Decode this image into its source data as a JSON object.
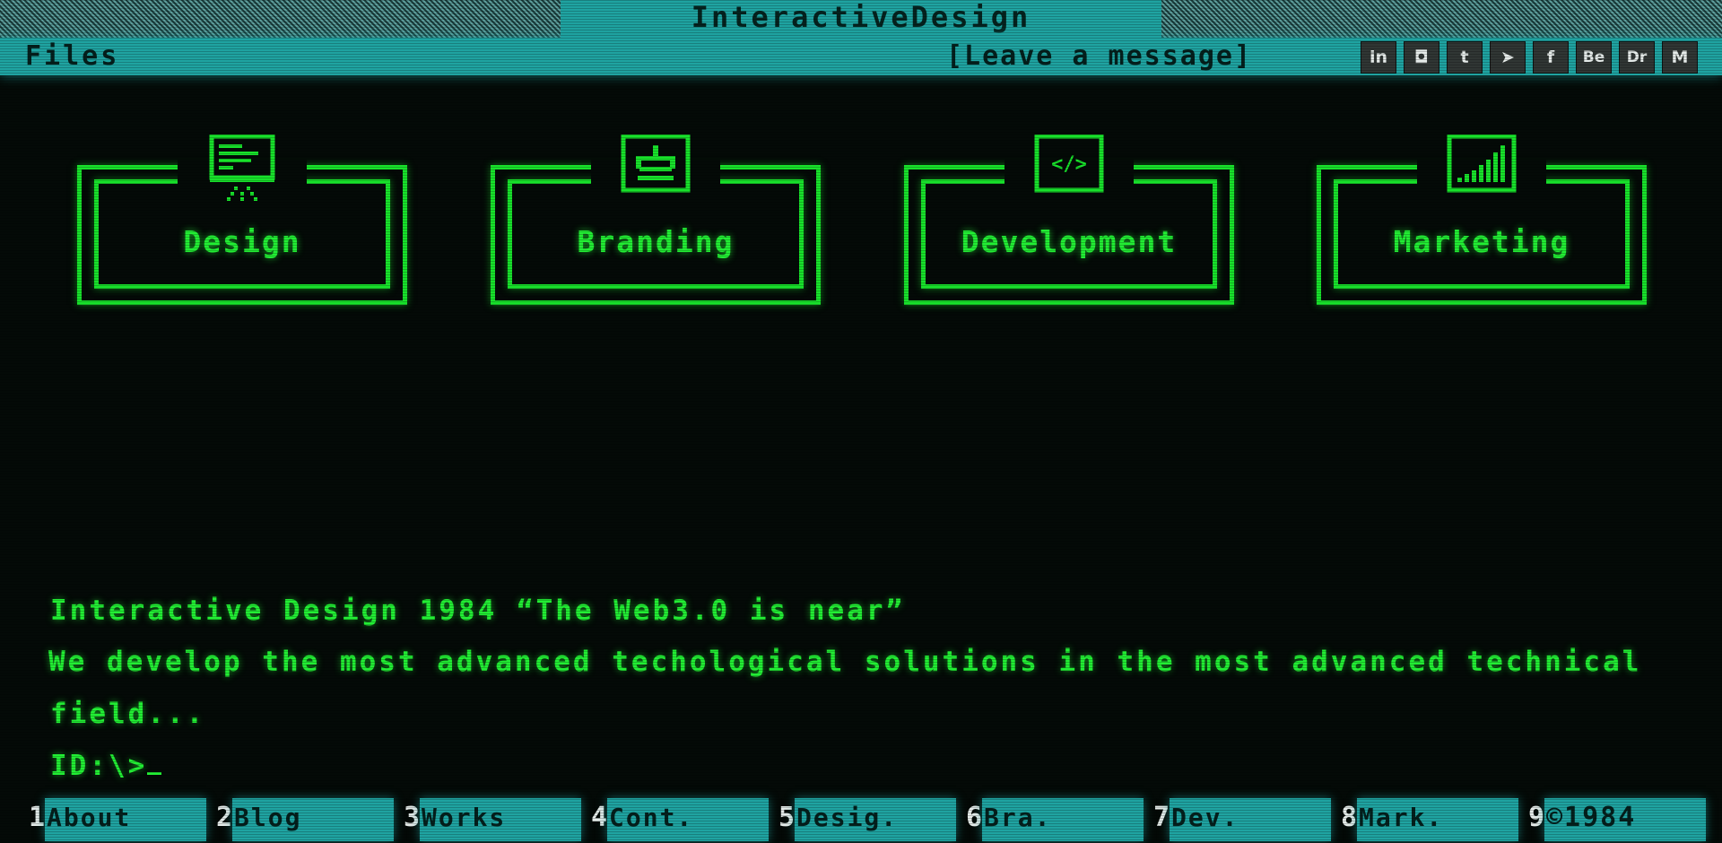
{
  "title": "InteractiveDesign",
  "menu": {
    "files": "Files",
    "message": "[Leave a message]"
  },
  "social": [
    {
      "label": "in",
      "icon": "linkedin-icon"
    },
    {
      "label": "◘",
      "icon": "instagram-icon"
    },
    {
      "label": "t",
      "icon": "tumblr-icon"
    },
    {
      "label": "➤",
      "icon": "telegram-icon"
    },
    {
      "label": "f",
      "icon": "facebook-icon"
    },
    {
      "label": "Be",
      "icon": "behance-icon"
    },
    {
      "label": "Dr",
      "icon": "dribbble-icon"
    },
    {
      "label": "M",
      "icon": "medium-icon"
    }
  ],
  "services": [
    {
      "label": "Design",
      "icon": "monitor-presentation-icon"
    },
    {
      "label": "Branding",
      "icon": "crown-icon"
    },
    {
      "label": "Development",
      "icon": "code-icon"
    },
    {
      "label": "Marketing",
      "icon": "signal-bars-icon"
    }
  ],
  "terminal": {
    "headline": "Interactive Design 1984 “The Web3.0 is near”",
    "line1": "We develop the most advanced techological solutions in the most advanced technical",
    "line2": "field...",
    "prompt": "ID:\\>"
  },
  "function_keys": [
    {
      "num": "1",
      "label": "About"
    },
    {
      "num": "2",
      "label": "Blog"
    },
    {
      "num": "3",
      "label": "Works"
    },
    {
      "num": "4",
      "label": "Cont."
    },
    {
      "num": "5",
      "label": "Desig."
    },
    {
      "num": "6",
      "label": "Bra."
    },
    {
      "num": "7",
      "label": "Dev."
    },
    {
      "num": "8",
      "label": "Mark."
    },
    {
      "num": "9",
      "label": "©1984"
    }
  ],
  "colors": {
    "terminal_green": "#22ee34",
    "teal": "#1fa3a1",
    "background": "#040a07"
  }
}
